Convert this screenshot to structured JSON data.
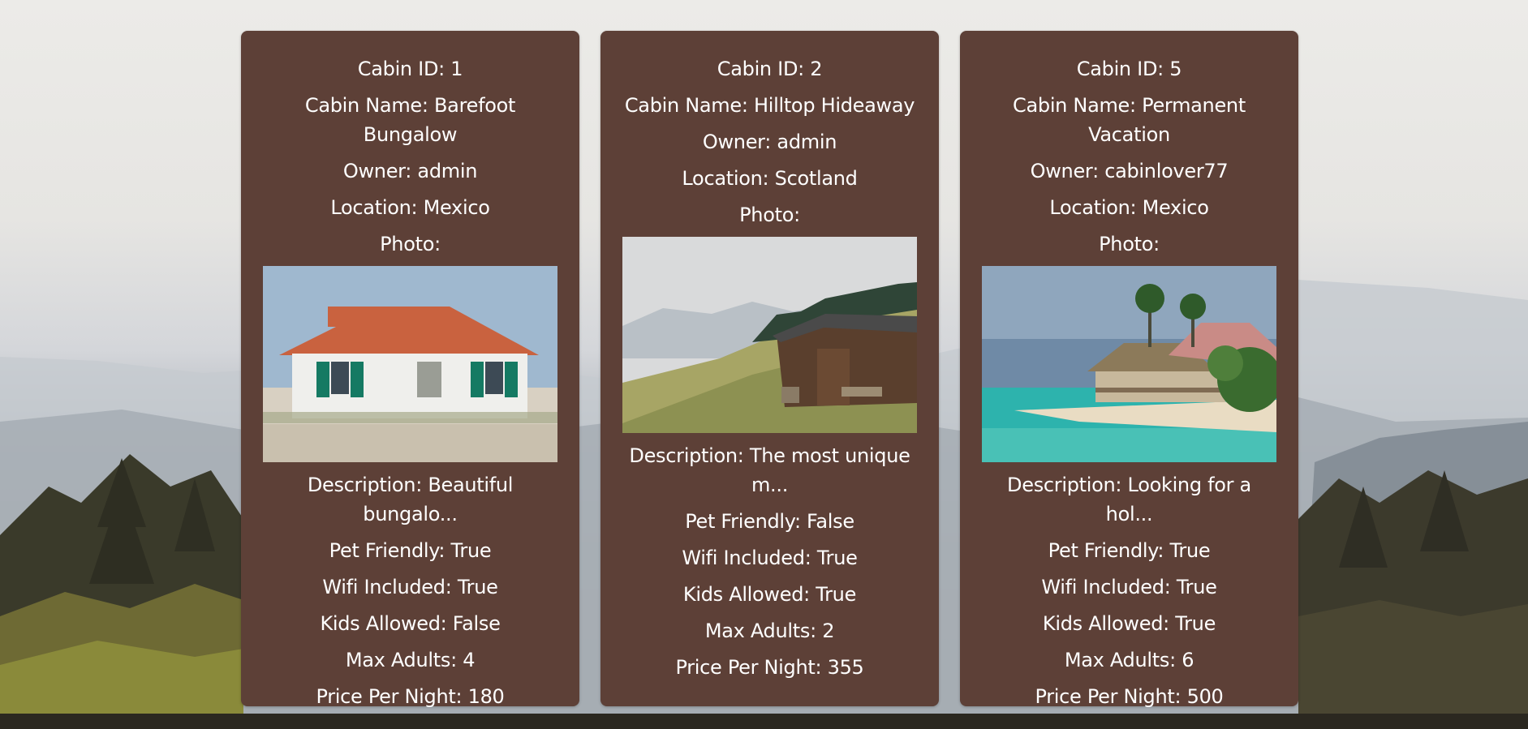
{
  "cabins": [
    {
      "id_label": "Cabin ID: 1",
      "name_label": "Cabin Name: Barefoot Bungalow",
      "owner_label": "Owner: admin",
      "location_label": "Location: Mexico",
      "photo_label": "Photo:",
      "description_label": "Description: Beautiful bungalo...",
      "pet_label": "Pet Friendly: True",
      "wifi_label": "Wifi Included: True",
      "kids_label": "Kids Allowed: False",
      "adults_label": "Max Adults: 4",
      "price_label": "Price Per Night: 180"
    },
    {
      "id_label": "Cabin ID: 2",
      "name_label": "Cabin Name: Hilltop Hideaway",
      "owner_label": "Owner: admin",
      "location_label": "Location: Scotland",
      "photo_label": "Photo:",
      "description_label": "Description: The most unique m...",
      "pet_label": "Pet Friendly: False",
      "wifi_label": "Wifi Included: True",
      "kids_label": "Kids Allowed: True",
      "adults_label": "Max Adults: 2",
      "price_label": "Price Per Night: 355"
    },
    {
      "id_label": "Cabin ID: 5",
      "name_label": "Cabin Name: Permanent Vacation",
      "owner_label": "Owner: cabinlover77",
      "location_label": "Location: Mexico",
      "photo_label": "Photo:",
      "description_label": "Description: Looking for a hol...",
      "pet_label": "Pet Friendly: True",
      "wifi_label": "Wifi Included: True",
      "kids_label": "Kids Allowed: True",
      "adults_label": "Max Adults: 6",
      "price_label": "Price Per Night: 500"
    }
  ],
  "colors": {
    "card_background": "#5d4037",
    "card_text": "#ffffff"
  }
}
